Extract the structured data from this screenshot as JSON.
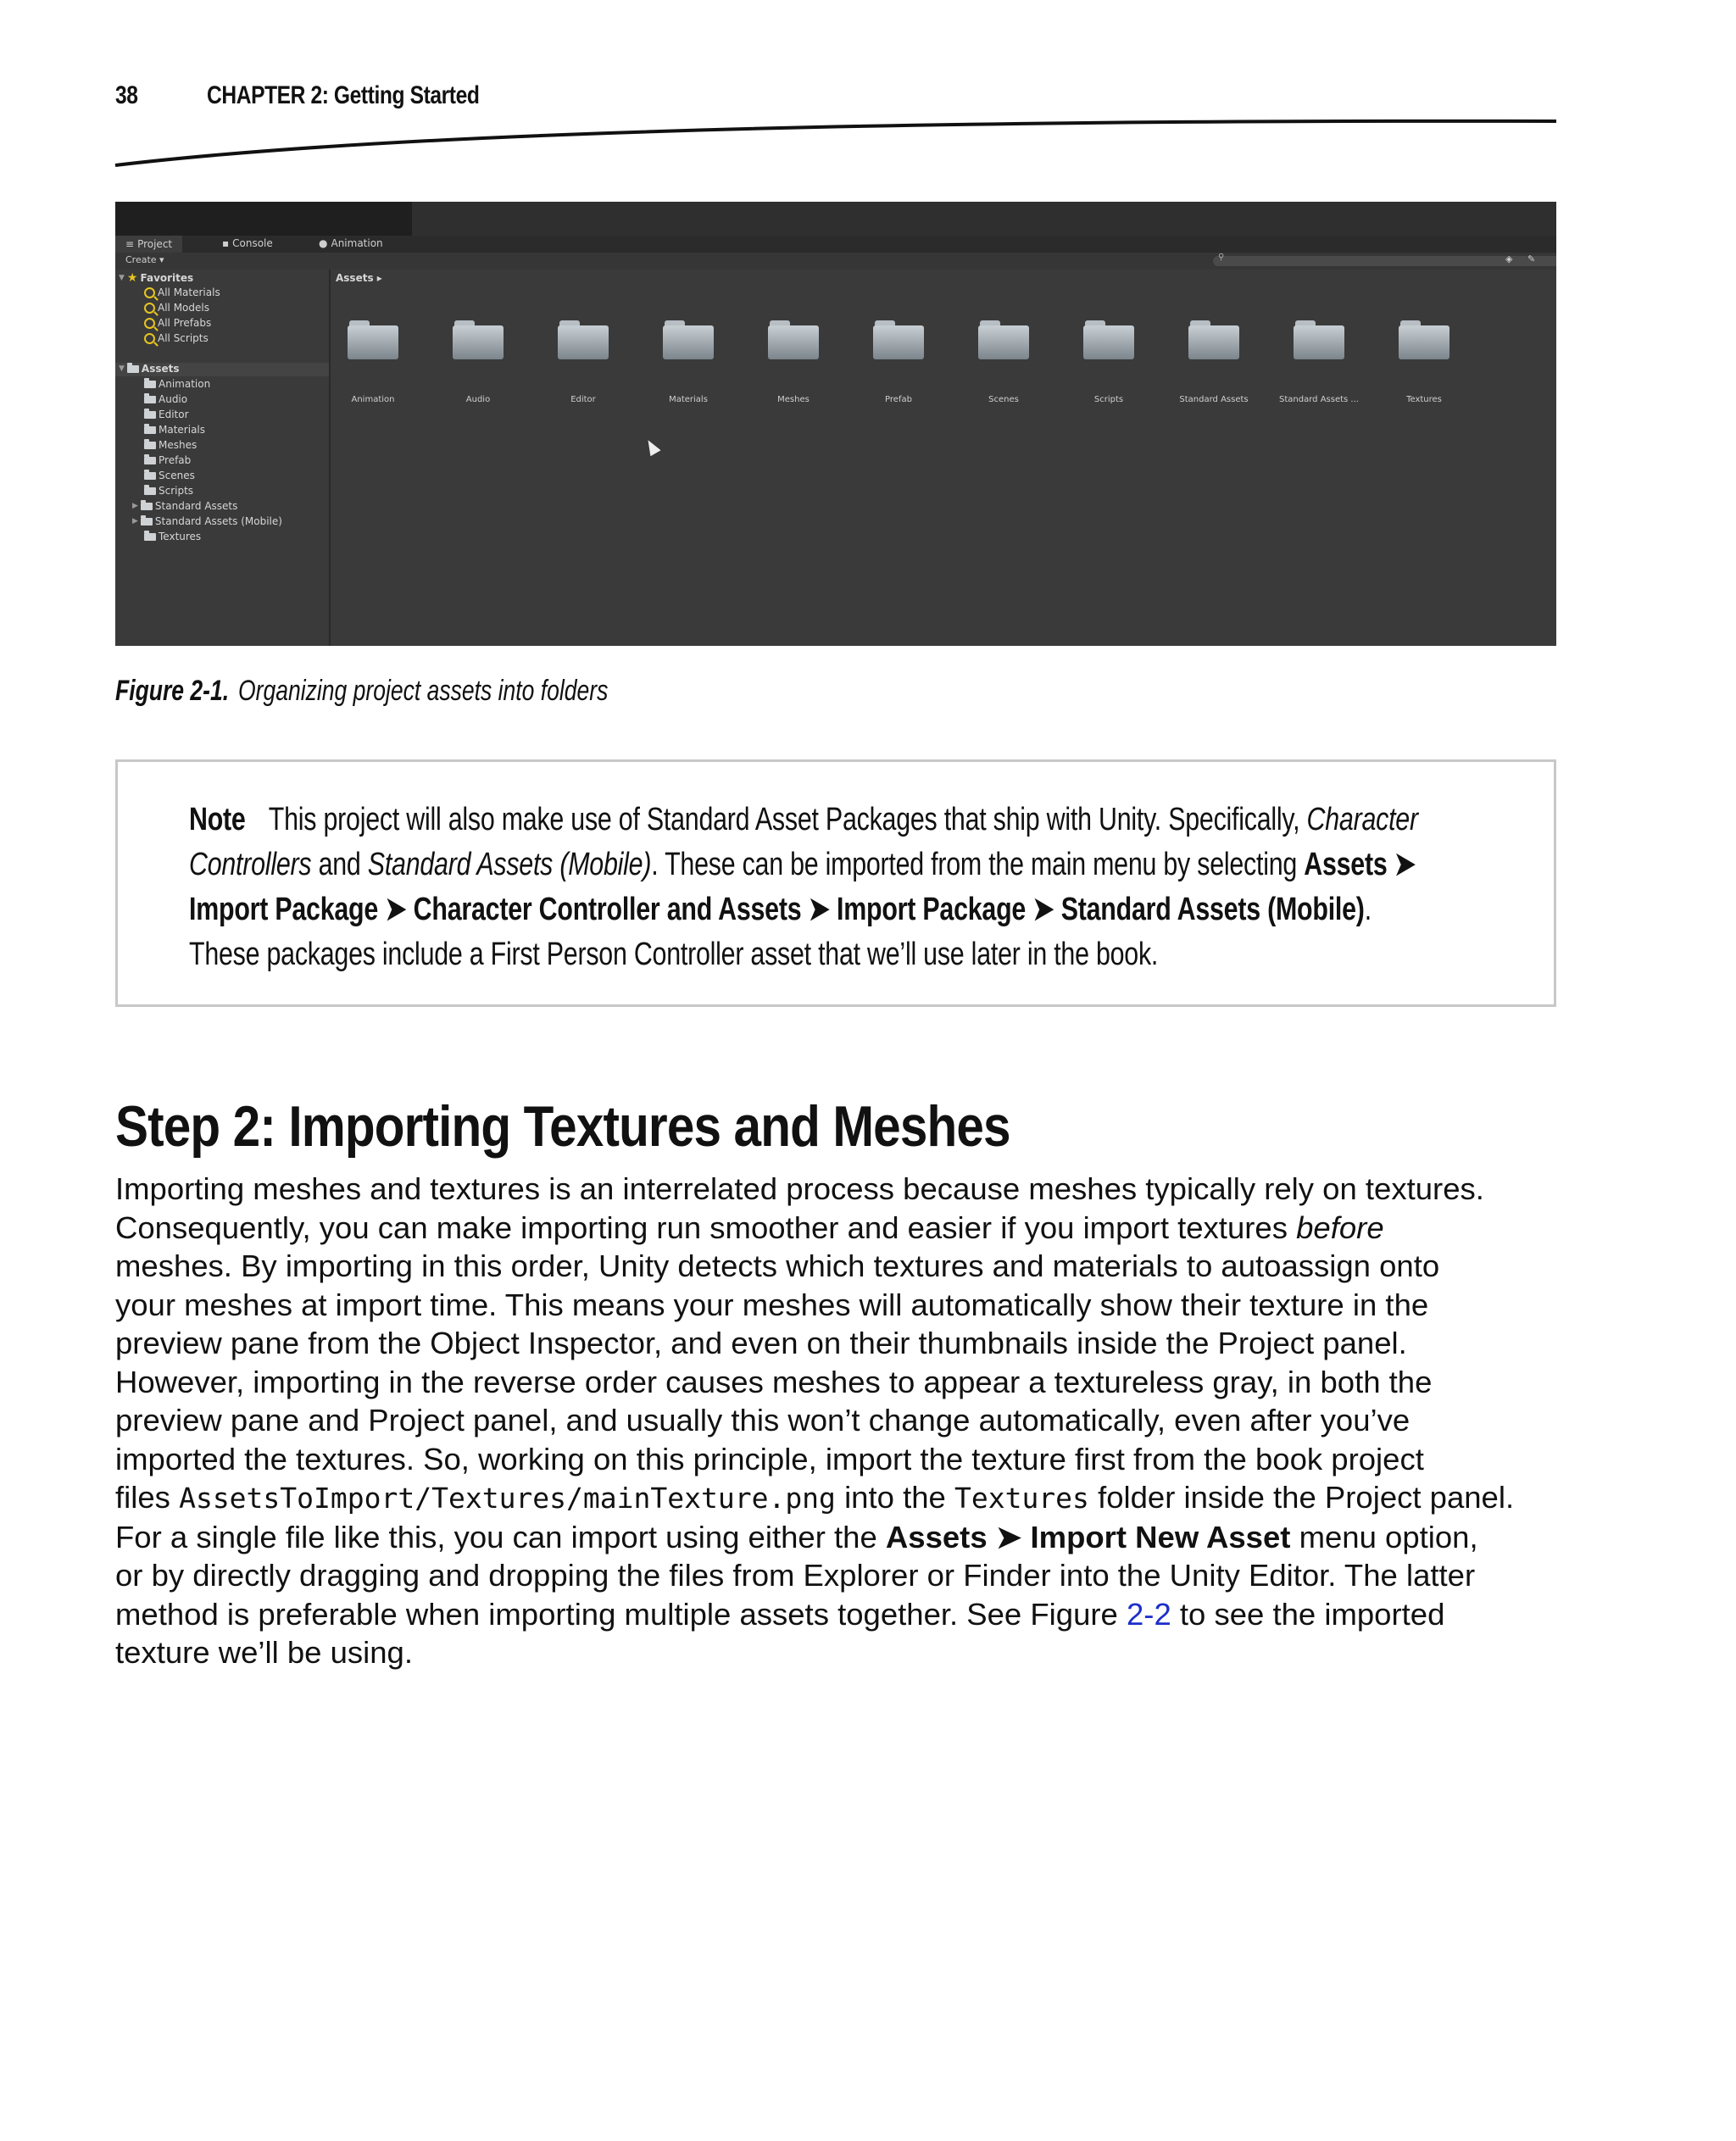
{
  "header": {
    "page_number": "38",
    "chapter_title": "CHAPTER 2: Getting Started"
  },
  "figure": {
    "tabs": [
      "Project",
      "Console",
      "Animation"
    ],
    "create_label": "Create",
    "favorites_label": "Favorites",
    "favorites": [
      "All Materials",
      "All Models",
      "All Prefabs",
      "All Scripts"
    ],
    "assets_label": "Assets",
    "breadcrumb": "Assets",
    "tree_folders": [
      "Animation",
      "Audio",
      "Editor",
      "Materials",
      "Meshes",
      "Prefab",
      "Scenes",
      "Scripts",
      "Standard Assets",
      "Standard Assets (Mobile)",
      "Textures"
    ],
    "grid_folders": [
      "Animation",
      "Audio",
      "Editor",
      "Materials",
      "Meshes",
      "Prefab",
      "Scenes",
      "Scripts",
      "Standard Assets",
      "Standard Assets ...",
      "Textures"
    ],
    "caption_label": "Figure 2-1.",
    "caption_text": "Organizing project assets into folders"
  },
  "note": {
    "label": "Note",
    "l1_text": "This project will also make use of Standard Asset Packages that ship with Unity. Specifically,",
    "l1_italic": "Character",
    "l2_italic1": "Controllers",
    "l2_and": "and",
    "l2_italic2": "Standard Assets (Mobile)",
    "l2_text": ". These can be imported from the main menu by selecting",
    "l2_bold": "Assets ➤",
    "l3_bold1": "Import Package ➤ Character Controller and Assets ➤ Import Package ➤ Standard Assets (Mobile)",
    "l3_end": ".",
    "l4_text": "These packages include a First Person Controller asset that we’ll use later in the book."
  },
  "section": {
    "heading": "Step 2: Importing Textures and Meshes",
    "l1": "Importing meshes and textures is an interrelated process because meshes typically rely on textures.",
    "l2_a": "Consequently, you can make importing run smoother and easier if you import textures",
    "l2_italic": "before",
    "l3": "meshes. By importing in this order, Unity detects which textures and materials to autoassign onto",
    "l4": "your meshes at import time. This means your meshes will automatically show their texture in the",
    "l5": "preview pane from the Object Inspector, and even on their thumbnails inside the Project panel.",
    "l6": "However, importing in the reverse order causes meshes to appear a textureless gray, in both the",
    "l7": "preview pane and Project panel, and usually this won’t change automatically, even after you’ve",
    "l8": "imported the textures. So, working on this principle, import the texture first from the book project",
    "l9_a": "files",
    "l9_code1": "AssetsToImport/Textures/mainTexture.png",
    "l9_b": "into the",
    "l9_code2": "Textures",
    "l9_c": "folder inside the Project panel.",
    "l10_a": "For a single file like this, you can import using either the",
    "l10_bold": "Assets ➤ Import New Asset",
    "l10_b": "menu option,",
    "l11": "or by directly dragging and dropping the files from Explorer or Finder into the Unity Editor. The latter",
    "l12_a": "method is preferable when importing multiple assets together. See Figure",
    "l12_link": "2-2",
    "l12_b": "to see the imported",
    "l13": "texture we’ll be using."
  },
  "colors": {
    "link": "#1d2fc8",
    "figure_bg": "#3a3a3a",
    "favorites_icon": "#e6c422"
  }
}
